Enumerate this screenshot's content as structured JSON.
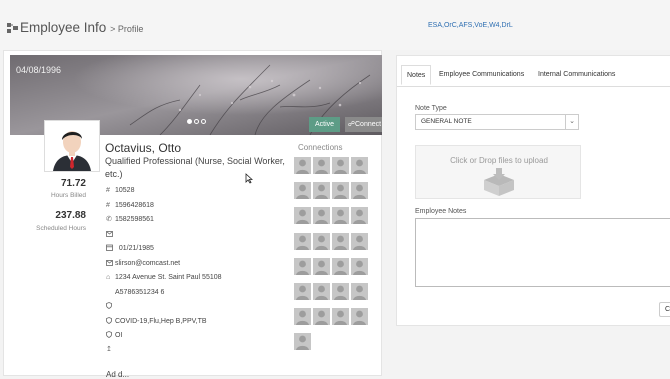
{
  "header": {
    "title": "Employee Info",
    "subtitle": "> Profile",
    "codes": "ESA,OrC,AFS,VoE,W4,DrL",
    "icon": "sitemap-icon"
  },
  "profile": {
    "banner_date": "04/08/1996",
    "status_button": "Active",
    "connect_button": "Connect",
    "name": "Octavius, Otto",
    "role": "Qualified Professional (Nurse, Social Worker, etc.)",
    "stats": [
      {
        "value": "71.72",
        "label": "Hours Billed"
      },
      {
        "value": "237.88",
        "label": "Scheduled Hours"
      }
    ],
    "fields": [
      {
        "icon": "hash-icon",
        "value": "10528"
      },
      {
        "icon": "hash-icon",
        "value": "1596428618"
      },
      {
        "icon": "phone-icon",
        "value": "1582598561"
      },
      {
        "icon": "envelope-icon",
        "value": ""
      },
      {
        "icon": "calendar-icon",
        "value": "01/21/1985"
      },
      {
        "icon": "envelope-icon",
        "value": "slirson@comcast.net"
      },
      {
        "icon": "home-icon",
        "value": "1234 Avenue St. Saint Paul 55108"
      },
      {
        "icon": "",
        "value": "A5786351234 6"
      },
      {
        "icon": "shield-icon",
        "value": ""
      },
      {
        "icon": "shield-icon",
        "value": "COVID-19,Flu,Hep B,PPV,TB"
      },
      {
        "icon": "shield-icon",
        "value": "OI"
      },
      {
        "icon": "arrow-icon",
        "value": ""
      }
    ],
    "more_label": "Ad d..."
  },
  "connections": {
    "title": "Connections",
    "count": 29
  },
  "tabs": [
    {
      "label": "Notes",
      "active": true
    },
    {
      "label": "Employee Communications",
      "active": false
    },
    {
      "label": "Internal Communications",
      "active": false
    }
  ],
  "notes_form": {
    "note_type_label": "Note Type",
    "note_type_value": "GENERAL NOTE",
    "upload_text": "Click or Drop files to upload",
    "employee_notes_label": "Employee Notes",
    "employee_notes_value": "",
    "button_label": "C"
  },
  "colors": {
    "active": "#5d9c86",
    "connect": "#8a8a8a",
    "link": "#2f6fb2"
  }
}
